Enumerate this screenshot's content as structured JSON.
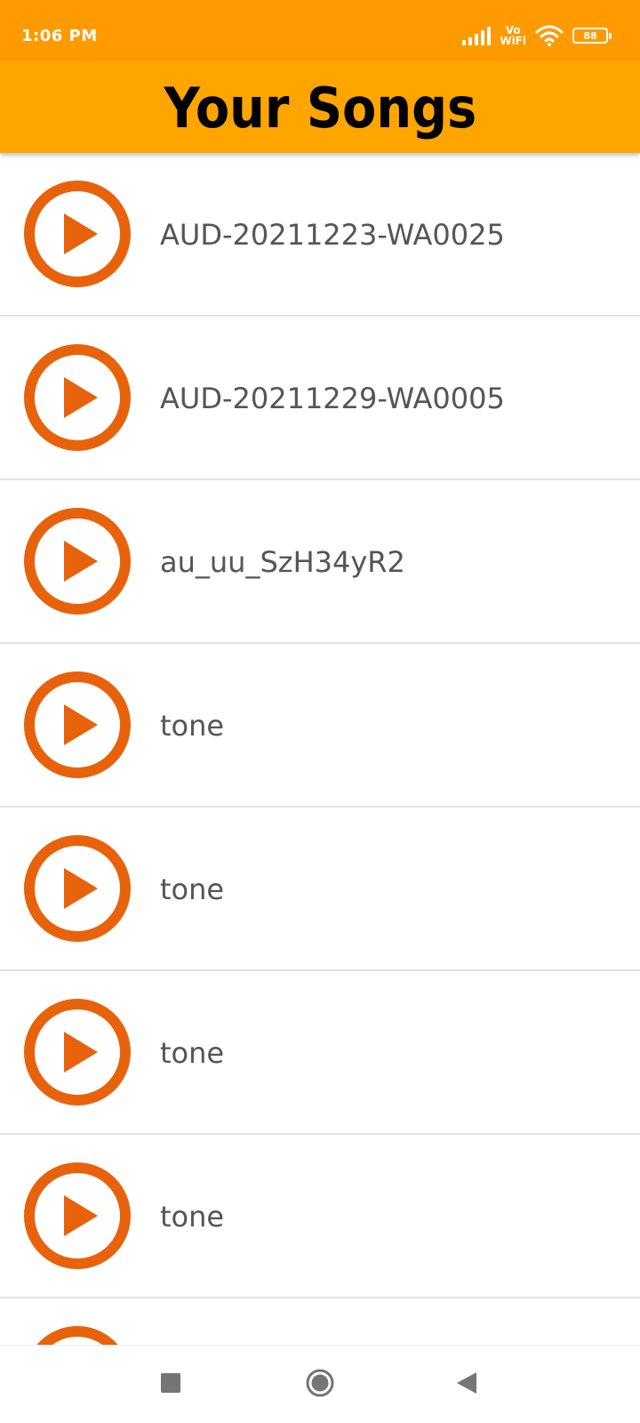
{
  "status_bar": {
    "time": "1:06 PM",
    "vowifi_top": "Vo",
    "vowifi_bottom": "WiFi",
    "battery_level": "88",
    "icons": [
      "signal-icon",
      "vowifi-icon",
      "wifi-icon",
      "battery-icon"
    ]
  },
  "header": {
    "title": "Your Songs"
  },
  "songs": [
    {
      "title": "AUD-20211223-WA0025"
    },
    {
      "title": "AUD-20211229-WA0005"
    },
    {
      "title": "au_uu_SzH34yR2"
    },
    {
      "title": "tone"
    },
    {
      "title": "tone"
    },
    {
      "title": "tone"
    },
    {
      "title": "tone"
    }
  ],
  "nav_bar": {
    "icons": [
      "recent-apps-icon",
      "home-icon",
      "back-icon"
    ]
  },
  "colors": {
    "status_bar": "#ff9a00",
    "header": "#ffa500",
    "play_accent": "#e8620c",
    "song_text": "#555555"
  }
}
